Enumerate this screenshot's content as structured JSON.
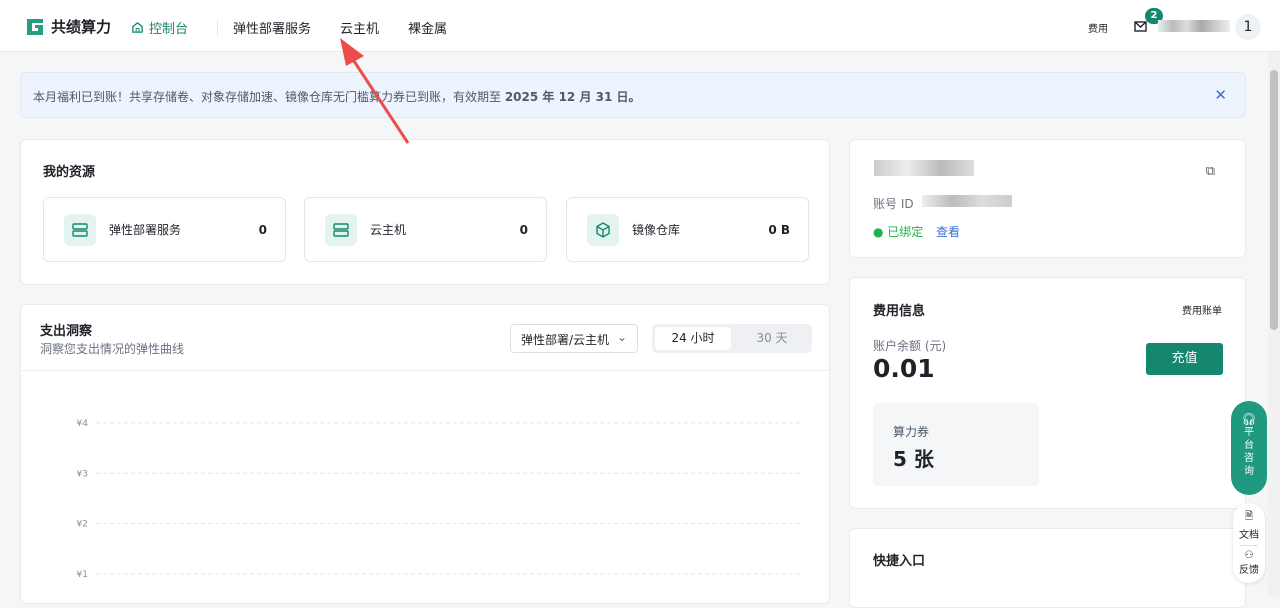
{
  "header": {
    "brand": "共绩算力",
    "nav": [
      "控制台",
      "弹性部署服务",
      "云主机",
      "裸金属"
    ],
    "fees": "费用",
    "mail_badge": "2",
    "avatar": "1"
  },
  "banner": {
    "text": "本月福利已到账！共享存储卷、对象存储加速、镜像仓库无门槛算力券已到账，有效期至 ",
    "date": "2025 年 12 月 31 日。"
  },
  "resources": {
    "title": "我的资源",
    "items": [
      {
        "label": "弹性部署服务",
        "value": "0"
      },
      {
        "label": "云主机",
        "value": "0"
      },
      {
        "label": "镜像仓库",
        "value": "0 B"
      }
    ]
  },
  "spend": {
    "title": "支出洞察",
    "subtitle": "洞察您支出情况的弹性曲线",
    "select": "弹性部署/云主机",
    "tabs": [
      "24 小时",
      "30 天"
    ]
  },
  "account": {
    "id_label": "账号 ID",
    "bound": "已绑定",
    "view": "查看"
  },
  "billing": {
    "title": "费用信息",
    "link": "费用账单",
    "balance_label": "账户余额 (元)",
    "balance": "0.01",
    "recharge": "充值",
    "voucher_label": "算力券",
    "voucher": "5 张"
  },
  "quick": {
    "title": "快捷入口"
  },
  "float": {
    "consult": [
      "平",
      "台",
      "咨",
      "询"
    ],
    "docs": "文档",
    "feedback": "反馈"
  },
  "chart_data": {
    "type": "line",
    "title": "支出洞察",
    "yticks": [
      "¥4",
      "¥3",
      "¥2",
      "¥1"
    ],
    "ylim": [
      0,
      4
    ],
    "series": [],
    "grid": true
  },
  "colors": {
    "brand": "#16876f",
    "annotation": "#ee4b4b"
  }
}
